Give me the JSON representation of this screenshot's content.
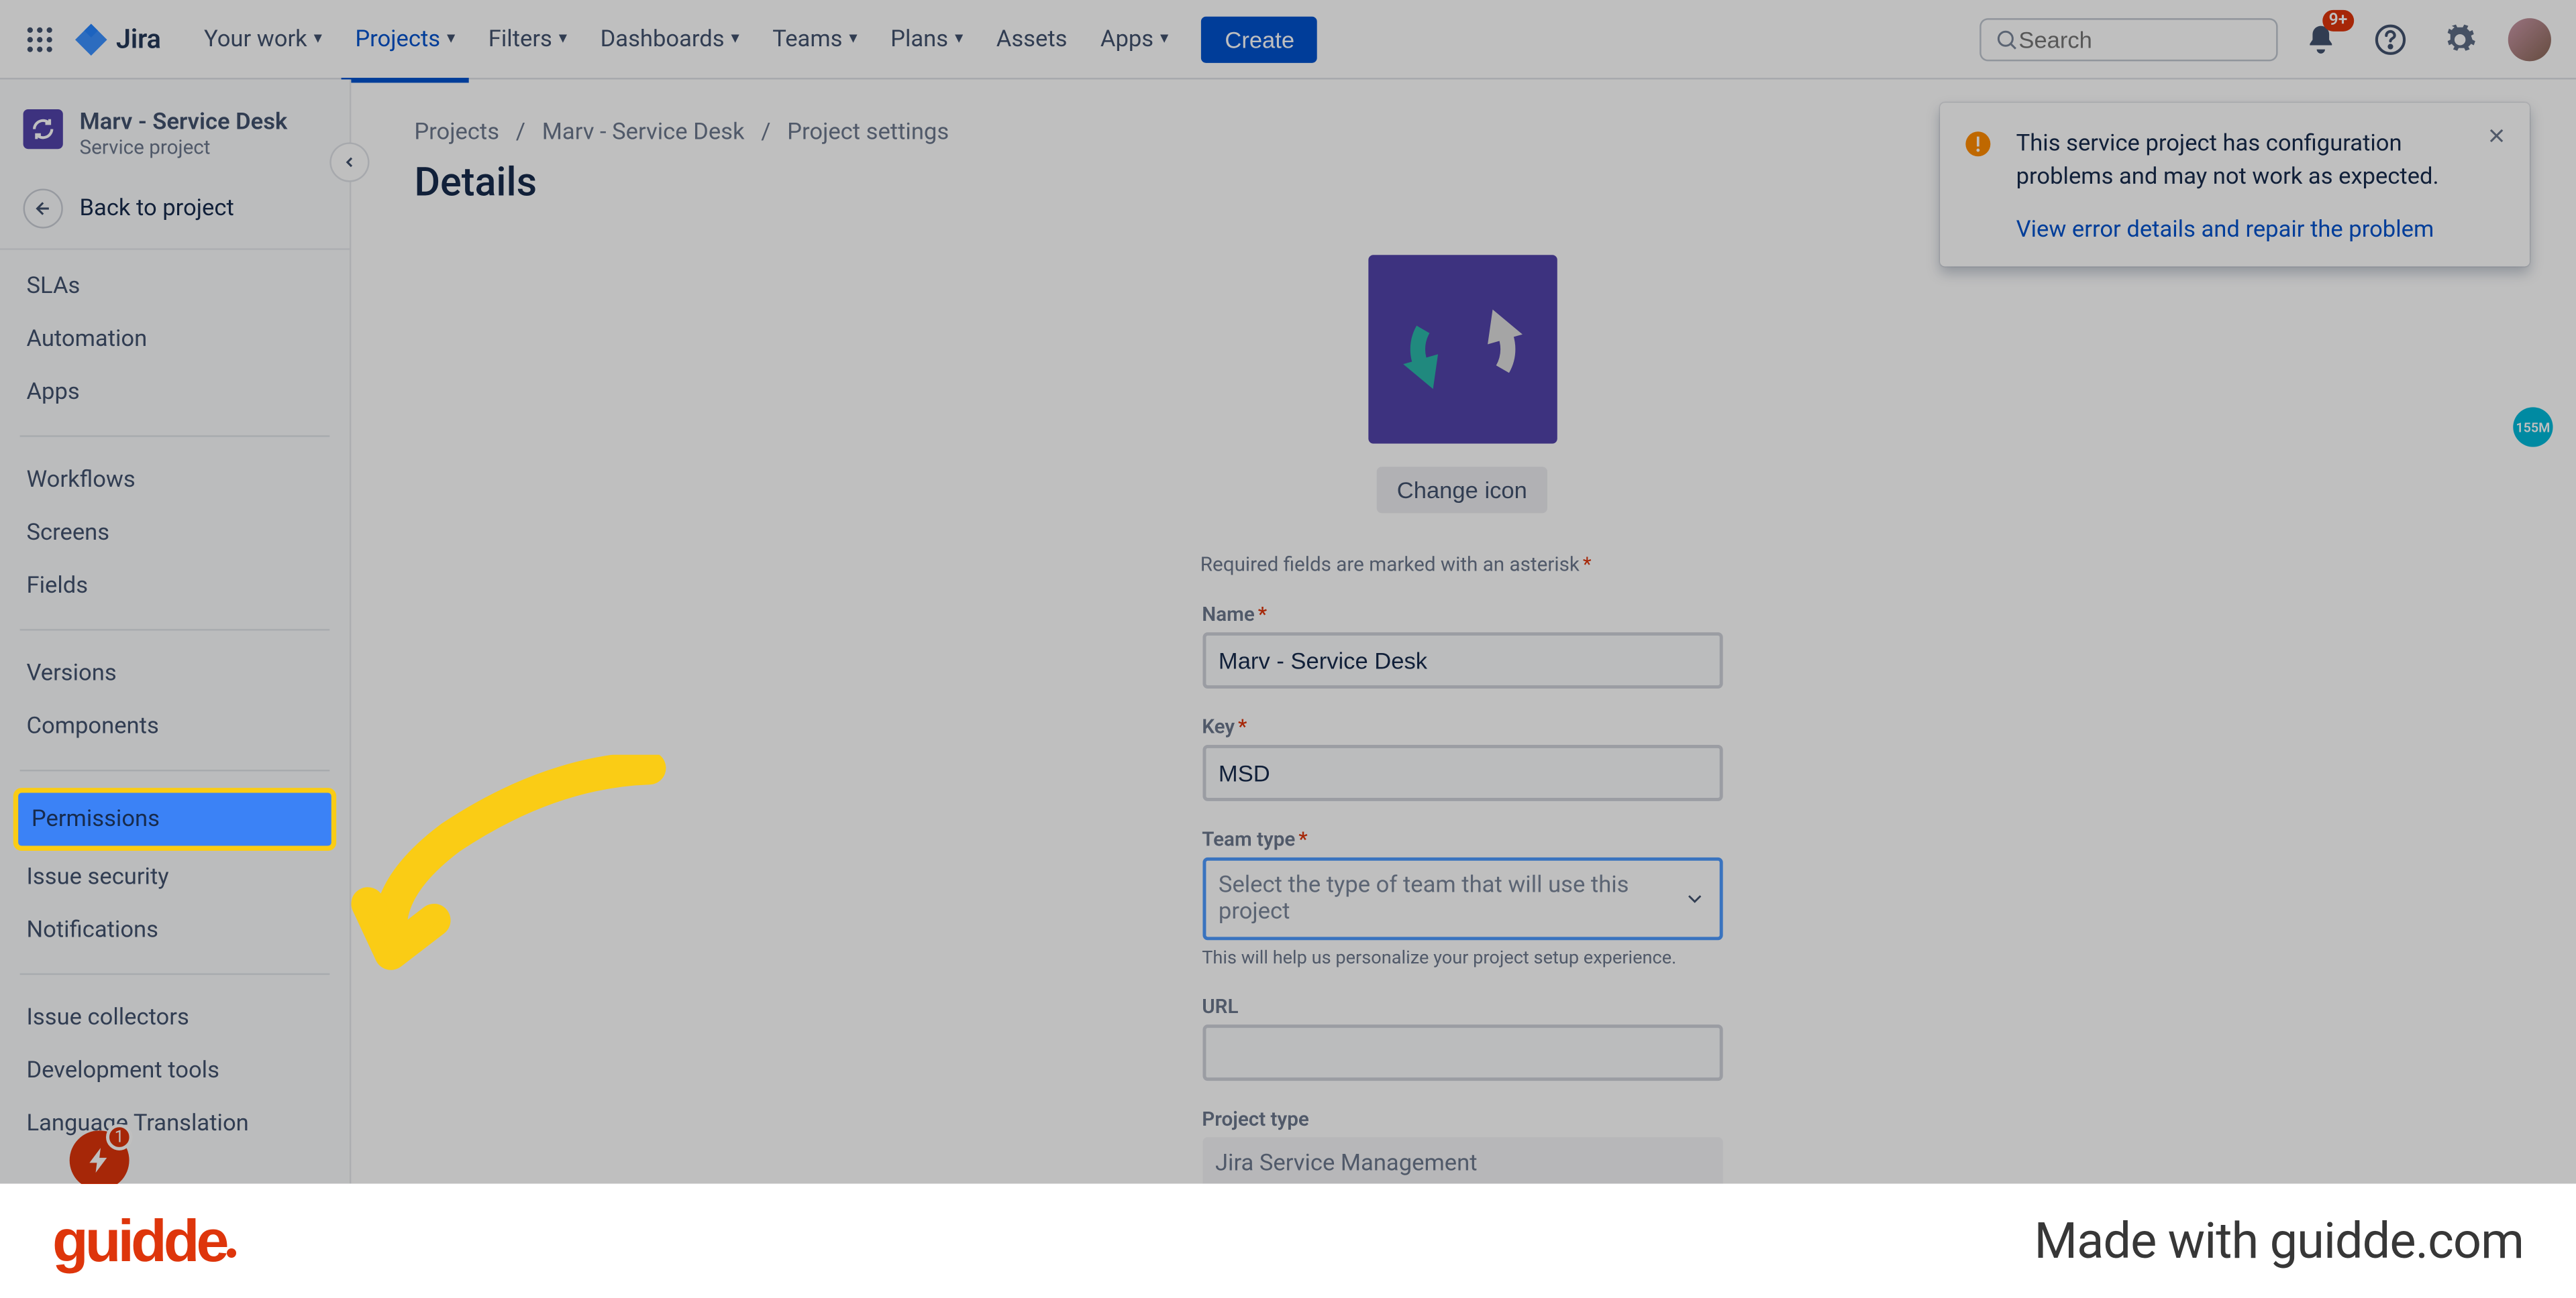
{
  "topnav": {
    "items": [
      "Your work",
      "Projects",
      "Filters",
      "Dashboards",
      "Teams",
      "Plans",
      "Assets",
      "Apps"
    ],
    "active_index": 1,
    "create": "Create",
    "search_placeholder": "Search",
    "notif_badge": "9+",
    "logo_text": "Jira"
  },
  "project": {
    "name": "Marv - Service Desk",
    "type": "Service project",
    "back_label": "Back to project"
  },
  "sidebar": {
    "groups": [
      [
        "SLAs",
        "Automation",
        "Apps"
      ],
      [
        "Workflows",
        "Screens",
        "Fields"
      ],
      [
        "Versions",
        "Components"
      ],
      [
        "Permissions",
        "Issue security",
        "Notifications"
      ],
      [
        "Issue collectors",
        "Development tools",
        "Language Translation"
      ]
    ],
    "highlight": "Permissions",
    "quick_count": "1"
  },
  "breadcrumbs": [
    "Projects",
    "Marv - Service Desk",
    "Project settings"
  ],
  "page_title": "Details",
  "form": {
    "change_icon": "Change icon",
    "required_note": "Required fields are marked with an asterisk",
    "name_label": "Name",
    "name_value": "Marv - Service Desk",
    "key_label": "Key",
    "key_value": "MSD",
    "team_label": "Team type",
    "team_placeholder": "Select the type of team that will use this project",
    "team_help": "This will help us personalize your project setup experience.",
    "url_label": "URL",
    "url_value": "",
    "ptype_label": "Project type",
    "ptype_value": "Jira Service Management"
  },
  "flag": {
    "message": "This service project has configuration problems and may not work as expected.",
    "link": "View error details and repair the problem"
  },
  "float_user": "155M",
  "guidde": {
    "brand": "guidde",
    "tagline": "Made with guidde.com"
  }
}
